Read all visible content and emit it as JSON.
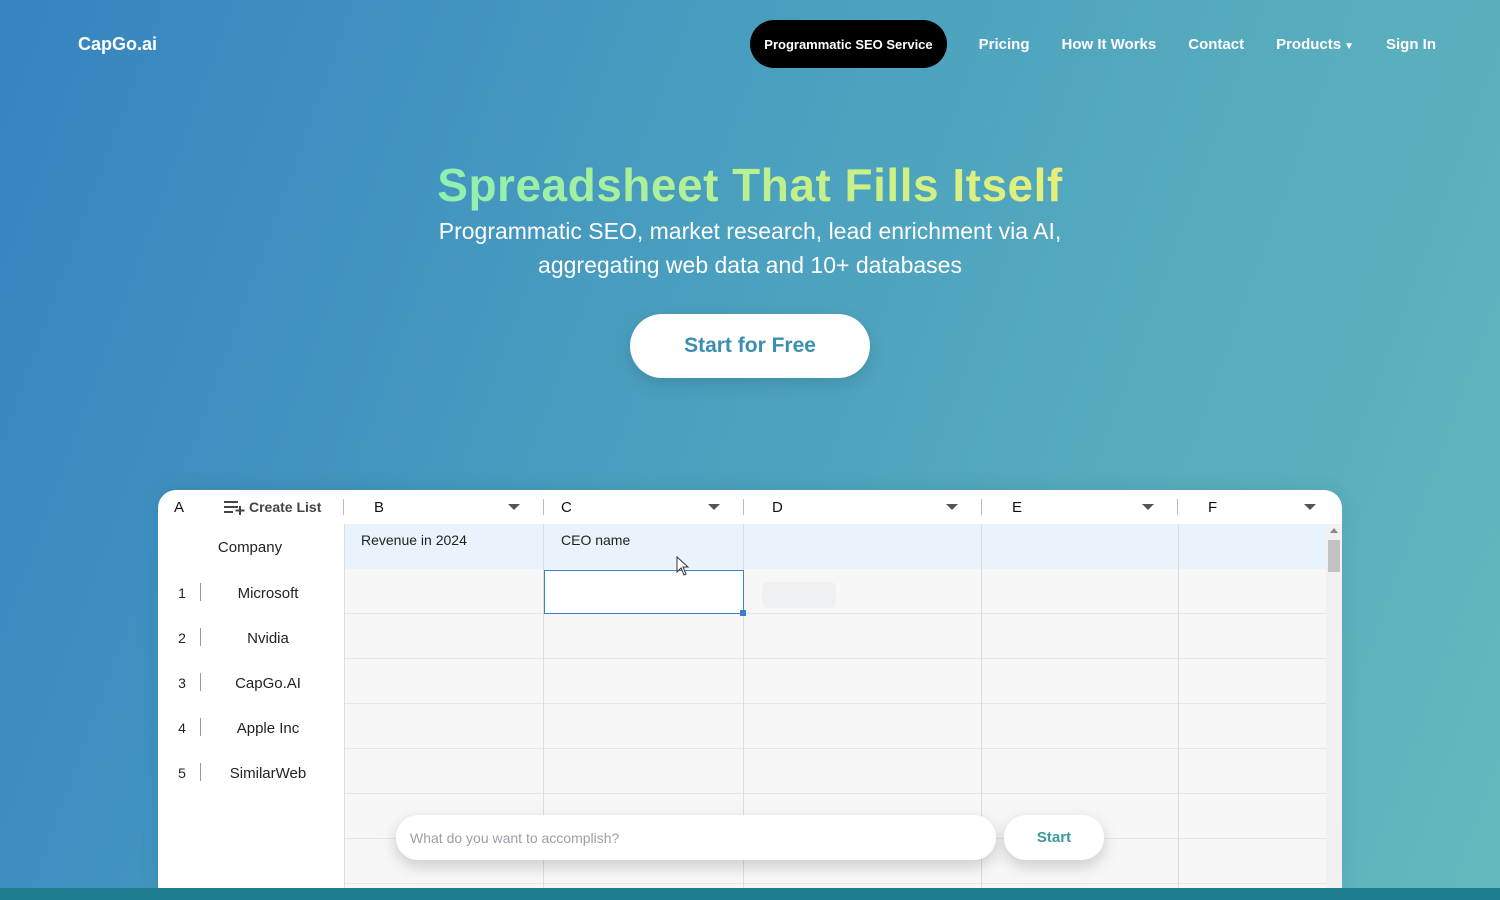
{
  "header": {
    "logo": "CapGo.ai",
    "nav": {
      "pseo": "Programmatic SEO Service",
      "pricing": "Pricing",
      "how": "How It Works",
      "contact": "Contact",
      "products": "Products",
      "signin": "Sign In"
    }
  },
  "hero": {
    "title": "Spreadsheet That Fills Itself",
    "subtitle": "Programmatic SEO, market research, lead enrichment via AI, aggregating web data and 10+ databases",
    "cta": "Start for Free"
  },
  "sheet": {
    "columns": {
      "a": "A",
      "create_list": "Create List",
      "b": "B",
      "c": "C",
      "d": "D",
      "e": "E",
      "f": "F"
    },
    "header_row": {
      "a": "Company",
      "b": "Revenue in 2024",
      "c": "CEO name"
    },
    "rows": [
      {
        "num": "1",
        "company": "Microsoft"
      },
      {
        "num": "2",
        "company": "Nvidia"
      },
      {
        "num": "3",
        "company": "CapGo.AI"
      },
      {
        "num": "4",
        "company": "Apple Inc"
      },
      {
        "num": "5",
        "company": "SimilarWeb"
      }
    ]
  },
  "prompt": {
    "placeholder": "What do you want to accomplish?",
    "start": "Start"
  },
  "colors": {
    "accent_green": "#8ef0b0",
    "cta_text": "#3a8fb0",
    "selection": "#3b7fd0"
  }
}
